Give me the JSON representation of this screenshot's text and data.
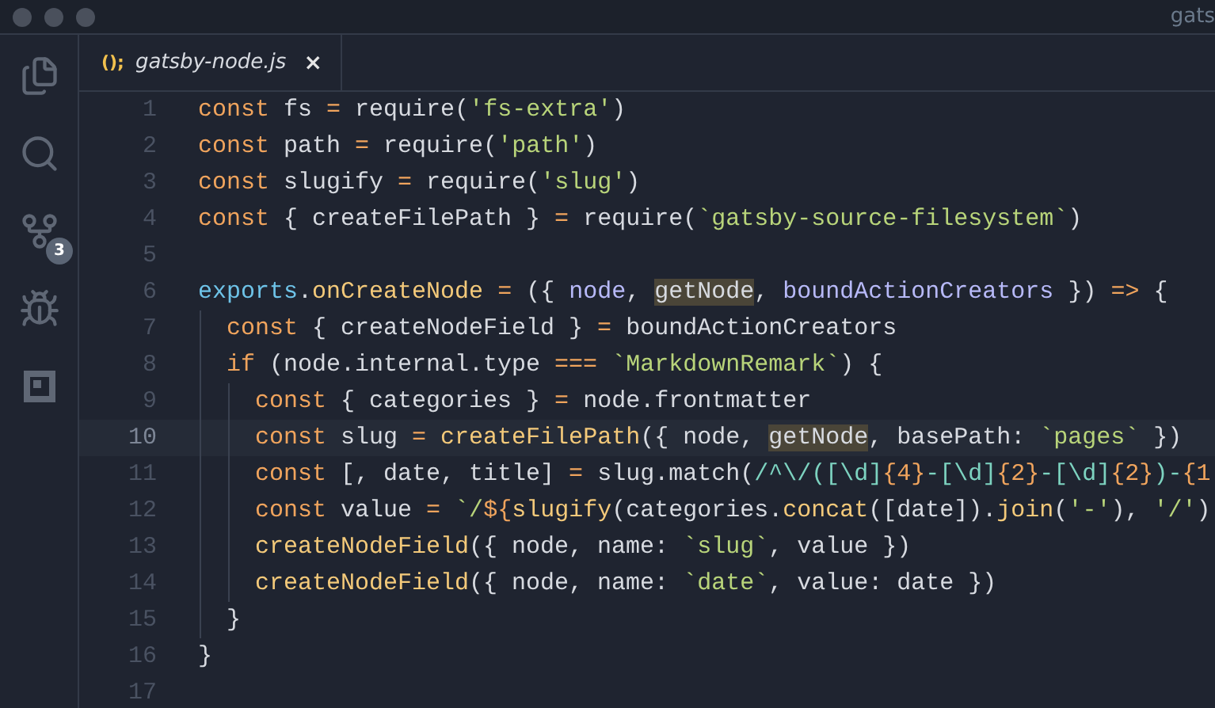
{
  "window": {
    "title": "gats"
  },
  "activity_bar": [
    {
      "kind": "files",
      "selected": false
    },
    {
      "kind": "search",
      "selected": false
    },
    {
      "kind": "source-control",
      "selected": false,
      "badge": "3"
    },
    {
      "kind": "debug",
      "selected": false
    },
    {
      "kind": "extensions",
      "selected": false
    }
  ],
  "tabs": [
    {
      "icon": "();",
      "label": "gatsby-node.js",
      "close": "×",
      "selected": true
    }
  ],
  "editor": {
    "lines": [
      {
        "number": "1",
        "current": false,
        "tokens": [
          {
            "kind": "kw",
            "text": "const"
          },
          {
            "kind": "plain",
            "text": " fs "
          },
          {
            "kind": "op",
            "text": "="
          },
          {
            "kind": "plain",
            "text": " require("
          },
          {
            "kind": "str",
            "text": "'fs-extra'"
          },
          {
            "kind": "plain",
            "text": ")"
          }
        ]
      },
      {
        "number": "2",
        "current": false,
        "tokens": [
          {
            "kind": "kw",
            "text": "const"
          },
          {
            "kind": "plain",
            "text": " path "
          },
          {
            "kind": "op",
            "text": "="
          },
          {
            "kind": "plain",
            "text": " require("
          },
          {
            "kind": "str",
            "text": "'path'"
          },
          {
            "kind": "plain",
            "text": ")"
          }
        ]
      },
      {
        "number": "3",
        "current": false,
        "tokens": [
          {
            "kind": "kw",
            "text": "const"
          },
          {
            "kind": "plain",
            "text": " slugify "
          },
          {
            "kind": "op",
            "text": "="
          },
          {
            "kind": "plain",
            "text": " require("
          },
          {
            "kind": "str",
            "text": "'slug'"
          },
          {
            "kind": "plain",
            "text": ")"
          }
        ]
      },
      {
        "number": "4",
        "current": false,
        "tokens": [
          {
            "kind": "kw",
            "text": "const"
          },
          {
            "kind": "plain",
            "text": " { createFilePath } "
          },
          {
            "kind": "op",
            "text": "="
          },
          {
            "kind": "plain",
            "text": " require("
          },
          {
            "kind": "str",
            "text": "`gatsby-source-filesystem`"
          },
          {
            "kind": "plain",
            "text": ")"
          }
        ]
      },
      {
        "number": "5",
        "current": false
      },
      {
        "number": "6",
        "current": false,
        "tokens": [
          {
            "kind": "obj",
            "text": "exports"
          },
          {
            "kind": "plain",
            "text": "."
          },
          {
            "kind": "fn",
            "text": "onCreateNode"
          },
          {
            "kind": "op",
            "text": " ="
          },
          {
            "kind": "plain",
            "text": " ({ "
          },
          {
            "kind": "param",
            "text": "node"
          },
          {
            "kind": "plain",
            "text": ", "
          },
          {
            "kind": "hl",
            "text": "getNode"
          },
          {
            "kind": "plain",
            "text": ", "
          },
          {
            "kind": "param",
            "text": "boundActionCreators"
          },
          {
            "kind": "plain",
            "text": " }) "
          },
          {
            "kind": "op",
            "text": "=>"
          },
          {
            "kind": "plain",
            "text": " {"
          }
        ]
      },
      {
        "number": "7",
        "current": false,
        "tokens": [
          {
            "kind": "kw",
            "text": "  const"
          },
          {
            "kind": "plain",
            "text": " { createNodeField } "
          },
          {
            "kind": "op",
            "text": "="
          },
          {
            "kind": "plain",
            "text": " boundActionCreators"
          }
        ]
      },
      {
        "number": "8",
        "current": false,
        "tokens": [
          {
            "kind": "kw",
            "text": "  if"
          },
          {
            "kind": "plain",
            "text": " (node.internal.type "
          },
          {
            "kind": "op",
            "text": "==="
          },
          {
            "kind": "str",
            "text": " `MarkdownRemark`"
          },
          {
            "kind": "plain",
            "text": ") {"
          }
        ]
      },
      {
        "number": "9",
        "current": false,
        "tokens": [
          {
            "kind": "kw",
            "text": "    const"
          },
          {
            "kind": "plain",
            "text": " { categories } "
          },
          {
            "kind": "op",
            "text": "="
          },
          {
            "kind": "plain",
            "text": " node.frontmatter"
          }
        ]
      },
      {
        "number": "10",
        "current": true,
        "tokens": [
          {
            "kind": "kw",
            "text": "    const"
          },
          {
            "kind": "plain",
            "text": " slug "
          },
          {
            "kind": "op",
            "text": "="
          },
          {
            "kind": "fn",
            "text": " createFilePath"
          },
          {
            "kind": "plain",
            "text": "({ node, "
          },
          {
            "kind": "hl",
            "text": "getNode"
          },
          {
            "kind": "plain",
            "text": ", basePath: "
          },
          {
            "kind": "str",
            "text": "`pages`"
          },
          {
            "kind": "plain",
            "text": " })"
          }
        ]
      },
      {
        "number": "11",
        "current": false,
        "tokens": [
          {
            "kind": "kw",
            "text": "    const"
          },
          {
            "kind": "plain",
            "text": " [, date, title] "
          },
          {
            "kind": "op",
            "text": "="
          },
          {
            "kind": "plain",
            "text": " slug.match("
          },
          {
            "kind": "regex",
            "text": "/^\\/([\\d]"
          },
          {
            "kind": "num",
            "text": "{4}"
          },
          {
            "kind": "regex",
            "text": "-[\\d]"
          },
          {
            "kind": "num",
            "text": "{2}"
          },
          {
            "kind": "regex",
            "text": "-[\\d]"
          },
          {
            "kind": "num",
            "text": "{2}"
          },
          {
            "kind": "regex",
            "text": ")-"
          },
          {
            "kind": "num",
            "text": "{1"
          }
        ]
      },
      {
        "number": "12",
        "current": false,
        "tokens": [
          {
            "kind": "kw",
            "text": "    const"
          },
          {
            "kind": "plain",
            "text": " value "
          },
          {
            "kind": "op",
            "text": "="
          },
          {
            "kind": "str",
            "text": " `/"
          },
          {
            "kind": "kw",
            "text": "${"
          },
          {
            "kind": "fn",
            "text": "slugify"
          },
          {
            "kind": "plain",
            "text": "(categories."
          },
          {
            "kind": "fn",
            "text": "concat"
          },
          {
            "kind": "plain",
            "text": "([date])."
          },
          {
            "kind": "fn",
            "text": "join"
          },
          {
            "kind": "plain",
            "text": "("
          },
          {
            "kind": "str",
            "text": "'-'"
          },
          {
            "kind": "plain",
            "text": "), "
          },
          {
            "kind": "str",
            "text": "'/'"
          },
          {
            "kind": "plain",
            "text": ")"
          }
        ]
      },
      {
        "number": "13",
        "current": false,
        "tokens": [
          {
            "kind": "fn",
            "text": "    createNodeField"
          },
          {
            "kind": "plain",
            "text": "({ node, name: "
          },
          {
            "kind": "str",
            "text": "`slug`"
          },
          {
            "kind": "plain",
            "text": ", value })"
          }
        ]
      },
      {
        "number": "14",
        "current": false,
        "tokens": [
          {
            "kind": "fn",
            "text": "    createNodeField"
          },
          {
            "kind": "plain",
            "text": "({ node, name: "
          },
          {
            "kind": "str",
            "text": "`date`"
          },
          {
            "kind": "plain",
            "text": ", value: date })"
          }
        ]
      },
      {
        "number": "15",
        "current": false,
        "tokens": [
          {
            "kind": "plain",
            "text": "  }"
          }
        ]
      },
      {
        "number": "16",
        "current": false,
        "tokens": [
          {
            "kind": "plain",
            "text": "}"
          }
        ]
      },
      {
        "number": "17",
        "current": false
      }
    ]
  }
}
